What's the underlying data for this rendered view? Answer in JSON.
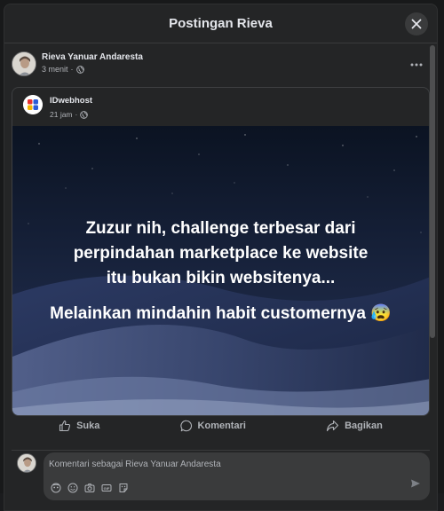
{
  "modal": {
    "title": "Postingan Rieva"
  },
  "post": {
    "author": "Rieva Yanuar Andaresta",
    "time": "3 menit",
    "privacy_icon": "globe-icon"
  },
  "shared_post": {
    "page_name": "IDwebhost",
    "time": "21 jam",
    "privacy_icon": "globe-icon",
    "image_text_1": "Zuzur nih, challenge terbesar dari perpindahan marketplace ke website itu bukan bikin websitenya...",
    "image_text_2": "Melainkan mindahin habit customernya 😰"
  },
  "actions": {
    "like": "Suka",
    "comment": "Komentari",
    "share": "Bagikan"
  },
  "composer": {
    "placeholder": "Komentari sebagai Rieva Yanuar Andaresta"
  },
  "colors": {
    "modal_bg": "#242526",
    "text_primary": "#e4e6eb",
    "text_secondary": "#b0b3b8",
    "input_bg": "#3a3b3c"
  }
}
